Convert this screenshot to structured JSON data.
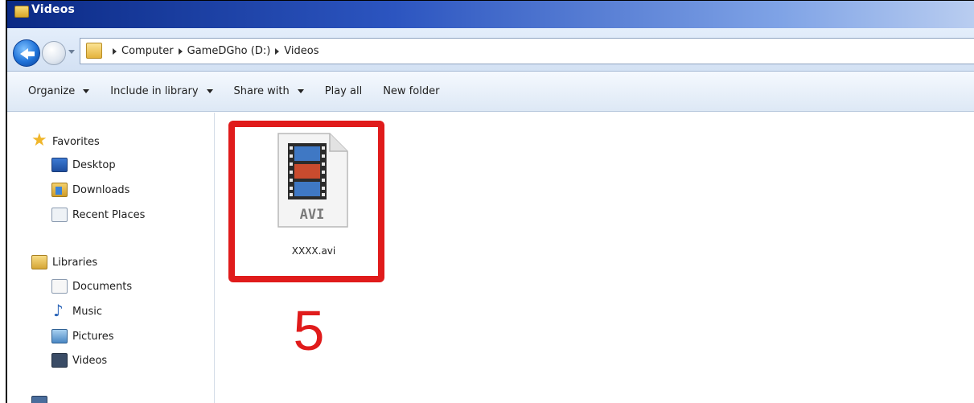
{
  "window": {
    "title": "Videos"
  },
  "address": {
    "crumbs": [
      "Computer",
      "GameDGho (D:)",
      "Videos"
    ]
  },
  "commands": {
    "organize": "Organize",
    "include_in_library": "Include in library",
    "share_with": "Share with",
    "play_all": "Play all",
    "new_folder": "New folder"
  },
  "nav": {
    "favorites": "Favorites",
    "desktop": "Desktop",
    "downloads": "Downloads",
    "recent_places": "Recent Places",
    "libraries": "Libraries",
    "documents": "Documents",
    "music": "Music",
    "pictures": "Pictures",
    "videos": "Videos"
  },
  "files": [
    {
      "name": "XXXX.avi",
      "type_label": "AVI"
    }
  ],
  "annotation": {
    "step": "5",
    "color": "#e01b1b"
  }
}
